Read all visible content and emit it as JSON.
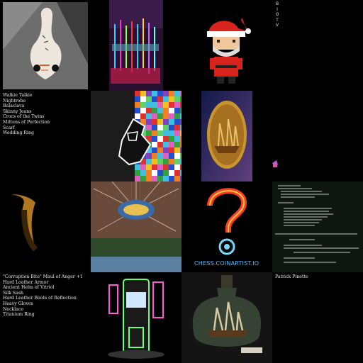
{
  "gallery": {
    "vertical_label": [
      "B",
      "I",
      "O",
      "T",
      "V"
    ],
    "list_one": [
      "Walkie Talkie",
      "Nightrobe",
      "Balaclava",
      "Skinny Jeans",
      "Crocs of the Twins",
      "Mittens of Perfection",
      "Scarf",
      "Wedding Ring"
    ],
    "list_two": [
      "\"Corruption Bite\" Maul of Anger +1",
      "Hard Leather Armor",
      "Ancient Helm of Vitriol",
      "Silk Sash",
      "Hard Leather Boots of Reflection",
      "Heavy Gloves",
      "Necklace",
      "Titanium Ring"
    ],
    "owner_name": "Patrick Pinette",
    "neon_caption": "CHESS.COINARTIST.IO"
  }
}
